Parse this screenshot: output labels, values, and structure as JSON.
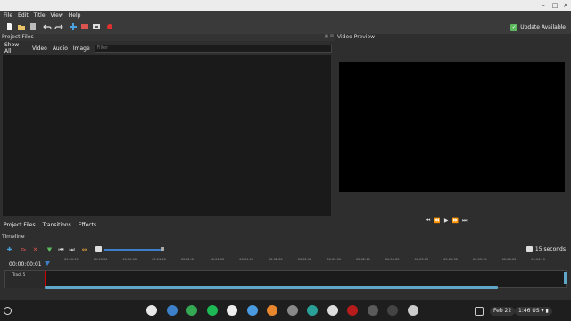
{
  "menu": [
    "File",
    "Edit",
    "Title",
    "View",
    "Help"
  ],
  "toolbar": {
    "icons": [
      "new-file-icon",
      "open-folder-icon",
      "save-icon",
      "undo-icon",
      "redo-icon",
      "import-icon",
      "profile-icon",
      "fullscreen-icon",
      "export-icon"
    ],
    "update_label": "Update Available"
  },
  "project_files": {
    "title": "Project Files",
    "filter_tabs": [
      "Show All",
      "Video",
      "Audio",
      "Image"
    ],
    "filter_placeholder": "Filter"
  },
  "bottom_tabs": [
    "Project Files",
    "Transitions",
    "Effects"
  ],
  "video_preview": {
    "title": "Video Preview",
    "controls": [
      "⏮",
      "⏪",
      "▶",
      "⏩",
      "⏭"
    ]
  },
  "timeline": {
    "title": "Timeline",
    "scale_label": "15 seconds",
    "timecode": "00:00:00:01",
    "track_name": "Track 5",
    "ruler_ticks": [
      "00:00:15",
      "00:00:30",
      "00:00:45",
      "00:01:00",
      "00:01:15",
      "00:01:30",
      "00:01:45",
      "00:02:00",
      "00:02:15",
      "00:02:30",
      "00:02:45",
      "00:03:00",
      "00:03:15",
      "00:03:30",
      "00:03:45",
      "00:04:00",
      "00:04:15"
    ]
  },
  "shelf": {
    "apps": [
      {
        "name": "chrome",
        "color": "#e8e8e8"
      },
      {
        "name": "files",
        "color": "#3e7fc9"
      },
      {
        "name": "chrome-alt",
        "color": "#34a853"
      },
      {
        "name": "spotify",
        "color": "#1db954"
      },
      {
        "name": "play-store",
        "color": "#eeeeee"
      },
      {
        "name": "photos",
        "color": "#4a9ae0"
      },
      {
        "name": "app-orange",
        "color": "#e8862d"
      },
      {
        "name": "app-gray",
        "color": "#888888"
      },
      {
        "name": "app-teal",
        "color": "#2aa198"
      },
      {
        "name": "app-white",
        "color": "#dddddd"
      },
      {
        "name": "app-red",
        "color": "#b71c1c"
      },
      {
        "name": "settings",
        "color": "#5a5a5a"
      },
      {
        "name": "terminal",
        "color": "#444444"
      },
      {
        "name": "app-mascot",
        "color": "#cccccc"
      }
    ],
    "date": "Feb 22",
    "time": "1:46",
    "locale": "US"
  }
}
